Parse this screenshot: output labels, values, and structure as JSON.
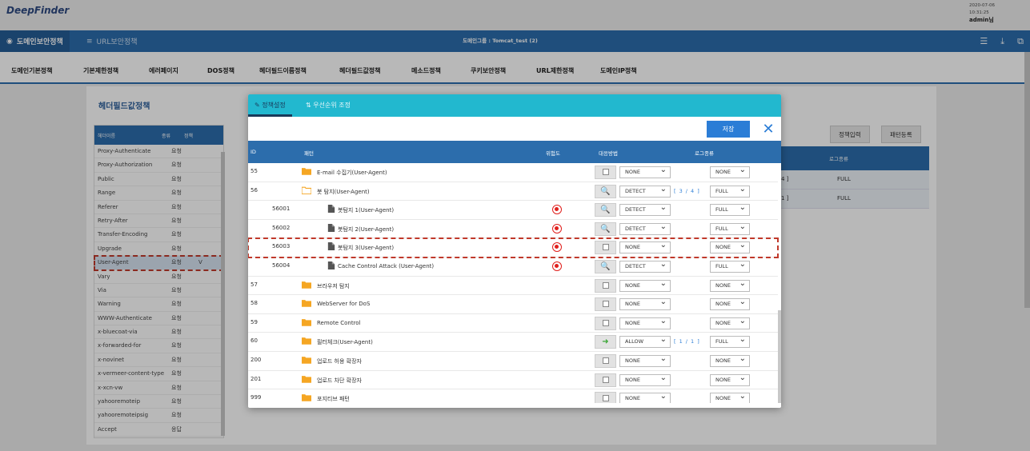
{
  "app": {
    "logo": "DeepFinder",
    "date": "2020-07-06",
    "time": "10:31:25",
    "user": "admin님"
  },
  "nav": {
    "tab1": "도메인보안정책",
    "tab2": "URL보안정책",
    "domain_group": "도메인그룹 : Tomcat_test (2)"
  },
  "menu": [
    "도메인기본정책",
    "기본제한정책",
    "에러페이지",
    "DOS정책",
    "헤더필드이름정책",
    "헤더필드값정책",
    "메소드정책",
    "쿠키보안정책",
    "URL제한정책",
    "도메인IP정책"
  ],
  "background": {
    "section_title": "헤더필드값정책",
    "list_head": {
      "name": "헤더이름",
      "type": "종류",
      "policy": "정책"
    },
    "list": [
      {
        "name": "Proxy-Authenticate",
        "type": "요청"
      },
      {
        "name": "Proxy-Authorization",
        "type": "요청"
      },
      {
        "name": "Public",
        "type": "요청"
      },
      {
        "name": "Range",
        "type": "요청"
      },
      {
        "name": "Referer",
        "type": "요청"
      },
      {
        "name": "Retry-After",
        "type": "요청"
      },
      {
        "name": "Transfer-Encoding",
        "type": "요청"
      },
      {
        "name": "Upgrade",
        "type": "요청"
      },
      {
        "name": "User-Agent",
        "type": "요청",
        "policy": "V"
      },
      {
        "name": "Vary",
        "type": "요청"
      },
      {
        "name": "Via",
        "type": "요청"
      },
      {
        "name": "Warning",
        "type": "요청"
      },
      {
        "name": "WWW-Authenticate",
        "type": "요청"
      },
      {
        "name": "x-bluecoat-via",
        "type": "요청"
      },
      {
        "name": "x-forwarded-for",
        "type": "요청"
      },
      {
        "name": "x-novinet",
        "type": "요청"
      },
      {
        "name": "x-vermeer-content-type",
        "type": "요청"
      },
      {
        "name": "x-xcn-vw",
        "type": "요청"
      },
      {
        "name": "yahooremoteip",
        "type": "요청"
      },
      {
        "name": "yahooremoteipsig",
        "type": "요청"
      },
      {
        "name": "Accept",
        "type": "응답"
      }
    ],
    "btn_policy_input": "정책입력",
    "btn_pattern_register": "패턴등록",
    "table_head_log": "로그종류",
    "rows": [
      {
        "count": "4 ]",
        "log": "FULL"
      },
      {
        "count": "1 ]",
        "log": "FULL"
      }
    ]
  },
  "modal": {
    "tab_active": "정책설정",
    "tab_inactive": "우선순위 조정",
    "save": "저장",
    "headers": {
      "id": "ID",
      "pattern": "패턴",
      "risk": "위험도",
      "action": "대응방법",
      "log": "로그종류"
    },
    "rows": [
      {
        "id": "55",
        "name": "E-mail 수집기(User-Agent)",
        "kind": "folder",
        "action": "NONE",
        "log": "NONE",
        "count": ""
      },
      {
        "id": "56",
        "name": "봇 탐지(User-Agent)",
        "kind": "folder-open",
        "action": "DETECT",
        "log": "FULL",
        "count": "[ 3 / 4 ]"
      },
      {
        "id": "56001",
        "name": "봇탐지 1(User-Agent)",
        "kind": "file",
        "risk": true,
        "action": "DETECT",
        "log": "FULL",
        "count": ""
      },
      {
        "id": "56002",
        "name": "봇탐지 2(User-Agent)",
        "kind": "file",
        "risk": true,
        "action": "DETECT",
        "log": "FULL",
        "count": ""
      },
      {
        "id": "56003",
        "name": "봇탐지 3(User-Agent)",
        "kind": "file",
        "risk": true,
        "action": "NONE",
        "log": "NONE",
        "count": "",
        "highlight": true
      },
      {
        "id": "56004",
        "name": "Cache Control Attack (User-Agent)",
        "kind": "file",
        "risk": true,
        "action": "DETECT",
        "log": "FULL",
        "count": ""
      },
      {
        "id": "57",
        "name": "브라우저 탐지",
        "kind": "folder",
        "action": "NONE",
        "log": "NONE",
        "count": ""
      },
      {
        "id": "58",
        "name": "WebServer for DoS",
        "kind": "folder",
        "action": "NONE",
        "log": "NONE",
        "count": ""
      },
      {
        "id": "59",
        "name": "Remote Control",
        "kind": "folder",
        "action": "NONE",
        "log": "NONE",
        "count": ""
      },
      {
        "id": "60",
        "name": "필터체크(User-Agent)",
        "kind": "folder",
        "action": "ALLOW",
        "log": "FULL",
        "count": "[ 1 / 1 ]"
      },
      {
        "id": "200",
        "name": "업로드 허용 확장자",
        "kind": "folder",
        "action": "NONE",
        "log": "NONE",
        "count": ""
      },
      {
        "id": "201",
        "name": "업로드 차단 확장자",
        "kind": "folder",
        "action": "NONE",
        "log": "NONE",
        "count": ""
      },
      {
        "id": "999",
        "name": "포지티브 패턴",
        "kind": "folder",
        "action": "NONE",
        "log": "NONE",
        "count": ""
      }
    ]
  },
  "colors": {
    "primary": "#2c6dac",
    "tab_bar": "#22b8cf",
    "save_btn": "#2b7dd6",
    "folder": "#f5a623",
    "risk": "#e0201d",
    "highlight": "#c0392b"
  }
}
